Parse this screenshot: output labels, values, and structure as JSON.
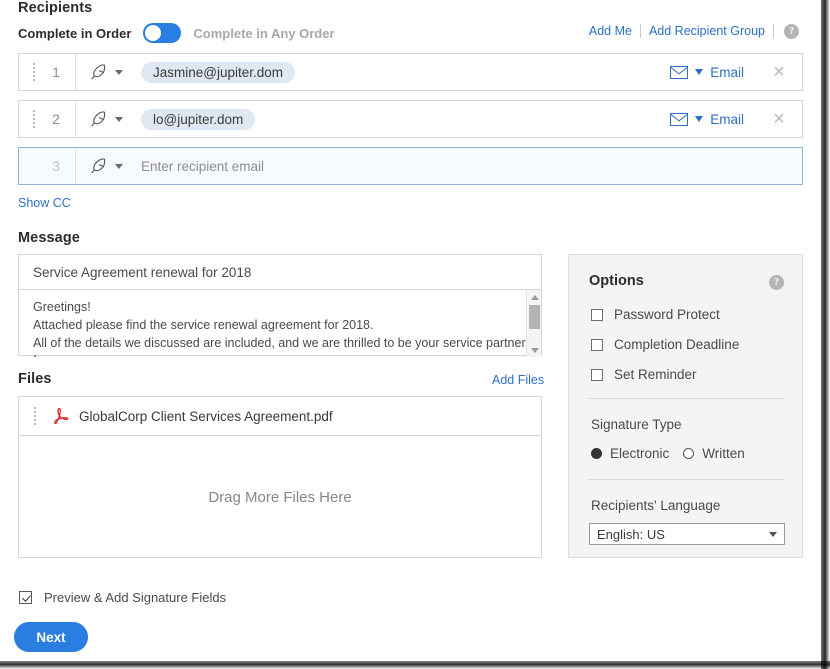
{
  "recipients": {
    "title": "Recipients",
    "complete_in_order_label": "Complete in Order",
    "complete_in_any_order_label": "Complete in Any Order",
    "toggle_state": "Complete in Order",
    "add_me_label": "Add Me",
    "add_recipient_group_label": "Add Recipient Group",
    "help_glyph": "?",
    "show_cc_label": "Show CC",
    "placeholder": "Enter recipient email",
    "rows": [
      {
        "number": "1",
        "email": "Jasmine@jupiter.dom",
        "delivery_type": "Email",
        "close_glyph": "×"
      },
      {
        "number": "2",
        "email": "lo@jupiter.dom",
        "delivery_type": "Email",
        "close_glyph": "×"
      },
      {
        "number": "3",
        "email": "",
        "delivery_type": "",
        "close_glyph": ""
      }
    ]
  },
  "message": {
    "title": "Message",
    "subject": "Service Agreement renewal for 2018",
    "body": "Greetings!\nAttached please find the service renewal agreement for 2018.\nAll of the details we discussed are included, and we are thrilled to be your service partner for"
  },
  "files": {
    "title": "Files",
    "add_files_label": "Add Files",
    "file_name": "GlobalCorp Client Services Agreement.pdf",
    "drop_zone_label": "Drag More Files Here"
  },
  "options": {
    "title": "Options",
    "help_glyph": "?",
    "checkboxes": [
      {
        "label": "Password Protect",
        "checked": false
      },
      {
        "label": "Completion Deadline",
        "checked": false
      },
      {
        "label": "Set Reminder",
        "checked": false
      }
    ],
    "signature_type_label": "Signature Type",
    "signature_options": [
      {
        "label": "Electronic",
        "selected": true
      },
      {
        "label": "Written",
        "selected": false
      }
    ],
    "language_label": "Recipients' Language",
    "language_value": "English: US"
  },
  "footer": {
    "preview_label": "Preview & Add Signature Fields",
    "preview_checked": true,
    "next_label": "Next"
  },
  "colors": {
    "accent_blue": "#2a7de1",
    "link_blue": "#2e6fc4",
    "chip_blue": "#dfe8f2",
    "panel_gray": "#f4f4f4",
    "pdf_red": "#d32b2b"
  }
}
